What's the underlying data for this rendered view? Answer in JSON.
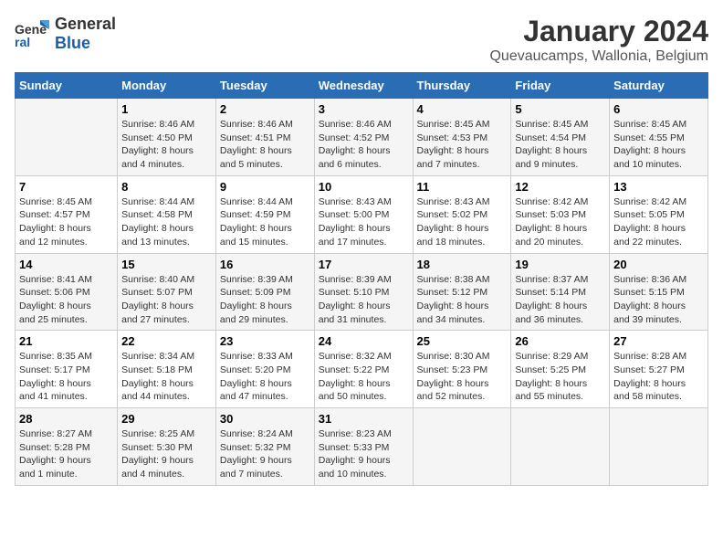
{
  "logo": {
    "general": "General",
    "blue": "Blue"
  },
  "title": "January 2024",
  "subtitle": "Quevaucamps, Wallonia, Belgium",
  "days_header": [
    "Sunday",
    "Monday",
    "Tuesday",
    "Wednesday",
    "Thursday",
    "Friday",
    "Saturday"
  ],
  "weeks": [
    [
      {
        "num": "",
        "info": ""
      },
      {
        "num": "1",
        "info": "Sunrise: 8:46 AM\nSunset: 4:50 PM\nDaylight: 8 hours\nand 4 minutes."
      },
      {
        "num": "2",
        "info": "Sunrise: 8:46 AM\nSunset: 4:51 PM\nDaylight: 8 hours\nand 5 minutes."
      },
      {
        "num": "3",
        "info": "Sunrise: 8:46 AM\nSunset: 4:52 PM\nDaylight: 8 hours\nand 6 minutes."
      },
      {
        "num": "4",
        "info": "Sunrise: 8:45 AM\nSunset: 4:53 PM\nDaylight: 8 hours\nand 7 minutes."
      },
      {
        "num": "5",
        "info": "Sunrise: 8:45 AM\nSunset: 4:54 PM\nDaylight: 8 hours\nand 9 minutes."
      },
      {
        "num": "6",
        "info": "Sunrise: 8:45 AM\nSunset: 4:55 PM\nDaylight: 8 hours\nand 10 minutes."
      }
    ],
    [
      {
        "num": "7",
        "info": "Sunrise: 8:45 AM\nSunset: 4:57 PM\nDaylight: 8 hours\nand 12 minutes."
      },
      {
        "num": "8",
        "info": "Sunrise: 8:44 AM\nSunset: 4:58 PM\nDaylight: 8 hours\nand 13 minutes."
      },
      {
        "num": "9",
        "info": "Sunrise: 8:44 AM\nSunset: 4:59 PM\nDaylight: 8 hours\nand 15 minutes."
      },
      {
        "num": "10",
        "info": "Sunrise: 8:43 AM\nSunset: 5:00 PM\nDaylight: 8 hours\nand 17 minutes."
      },
      {
        "num": "11",
        "info": "Sunrise: 8:43 AM\nSunset: 5:02 PM\nDaylight: 8 hours\nand 18 minutes."
      },
      {
        "num": "12",
        "info": "Sunrise: 8:42 AM\nSunset: 5:03 PM\nDaylight: 8 hours\nand 20 minutes."
      },
      {
        "num": "13",
        "info": "Sunrise: 8:42 AM\nSunset: 5:05 PM\nDaylight: 8 hours\nand 22 minutes."
      }
    ],
    [
      {
        "num": "14",
        "info": "Sunrise: 8:41 AM\nSunset: 5:06 PM\nDaylight: 8 hours\nand 25 minutes."
      },
      {
        "num": "15",
        "info": "Sunrise: 8:40 AM\nSunset: 5:07 PM\nDaylight: 8 hours\nand 27 minutes."
      },
      {
        "num": "16",
        "info": "Sunrise: 8:39 AM\nSunset: 5:09 PM\nDaylight: 8 hours\nand 29 minutes."
      },
      {
        "num": "17",
        "info": "Sunrise: 8:39 AM\nSunset: 5:10 PM\nDaylight: 8 hours\nand 31 minutes."
      },
      {
        "num": "18",
        "info": "Sunrise: 8:38 AM\nSunset: 5:12 PM\nDaylight: 8 hours\nand 34 minutes."
      },
      {
        "num": "19",
        "info": "Sunrise: 8:37 AM\nSunset: 5:14 PM\nDaylight: 8 hours\nand 36 minutes."
      },
      {
        "num": "20",
        "info": "Sunrise: 8:36 AM\nSunset: 5:15 PM\nDaylight: 8 hours\nand 39 minutes."
      }
    ],
    [
      {
        "num": "21",
        "info": "Sunrise: 8:35 AM\nSunset: 5:17 PM\nDaylight: 8 hours\nand 41 minutes."
      },
      {
        "num": "22",
        "info": "Sunrise: 8:34 AM\nSunset: 5:18 PM\nDaylight: 8 hours\nand 44 minutes."
      },
      {
        "num": "23",
        "info": "Sunrise: 8:33 AM\nSunset: 5:20 PM\nDaylight: 8 hours\nand 47 minutes."
      },
      {
        "num": "24",
        "info": "Sunrise: 8:32 AM\nSunset: 5:22 PM\nDaylight: 8 hours\nand 50 minutes."
      },
      {
        "num": "25",
        "info": "Sunrise: 8:30 AM\nSunset: 5:23 PM\nDaylight: 8 hours\nand 52 minutes."
      },
      {
        "num": "26",
        "info": "Sunrise: 8:29 AM\nSunset: 5:25 PM\nDaylight: 8 hours\nand 55 minutes."
      },
      {
        "num": "27",
        "info": "Sunrise: 8:28 AM\nSunset: 5:27 PM\nDaylight: 8 hours\nand 58 minutes."
      }
    ],
    [
      {
        "num": "28",
        "info": "Sunrise: 8:27 AM\nSunset: 5:28 PM\nDaylight: 9 hours\nand 1 minute."
      },
      {
        "num": "29",
        "info": "Sunrise: 8:25 AM\nSunset: 5:30 PM\nDaylight: 9 hours\nand 4 minutes."
      },
      {
        "num": "30",
        "info": "Sunrise: 8:24 AM\nSunset: 5:32 PM\nDaylight: 9 hours\nand 7 minutes."
      },
      {
        "num": "31",
        "info": "Sunrise: 8:23 AM\nSunset: 5:33 PM\nDaylight: 9 hours\nand 10 minutes."
      },
      {
        "num": "",
        "info": ""
      },
      {
        "num": "",
        "info": ""
      },
      {
        "num": "",
        "info": ""
      }
    ]
  ]
}
